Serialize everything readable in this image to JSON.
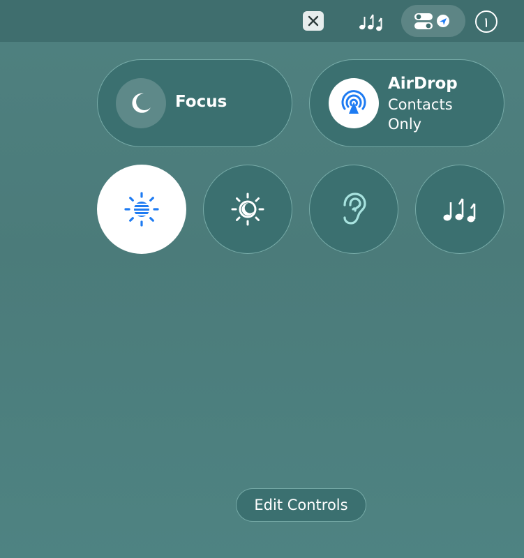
{
  "colors": {
    "accent": "#1e7bf2",
    "tile_background": "#3b7070",
    "menubar_background": "#3f6e6e"
  },
  "menubar": {
    "items": [
      {
        "name": "close-app-icon"
      },
      {
        "name": "music-notes-icon"
      },
      {
        "name": "control-center-toggle-icon"
      },
      {
        "name": "clock-icon"
      }
    ]
  },
  "controls": {
    "focus": {
      "label": "Focus",
      "icon": "moon-icon"
    },
    "airdrop": {
      "title": "AirDrop",
      "subtitle": "Contacts Only",
      "icon": "airdrop-icon"
    },
    "round_buttons": [
      {
        "icon": "display-brightness-icon",
        "active": true
      },
      {
        "icon": "night-shift-icon",
        "active": false
      },
      {
        "icon": "hearing-ear-icon",
        "active": false
      },
      {
        "icon": "music-recognition-icon",
        "active": false
      }
    ]
  },
  "footer": {
    "edit_label": "Edit Controls"
  }
}
